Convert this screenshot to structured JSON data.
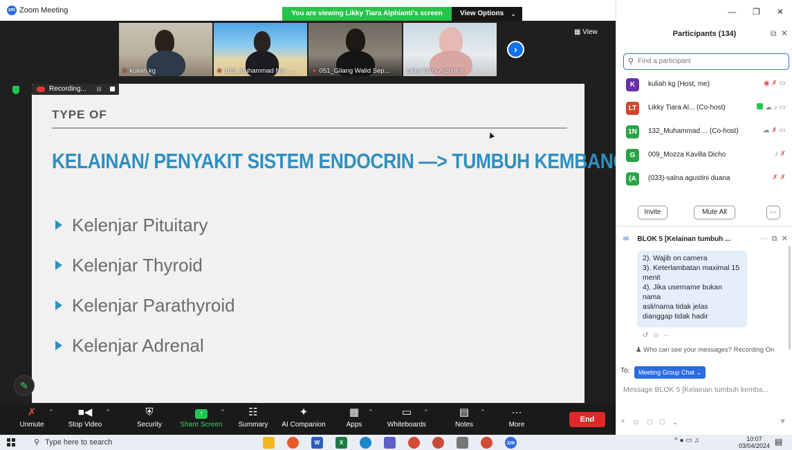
{
  "window": {
    "title": "Zoom Meeting",
    "viewing_banner": "You are viewing Likky Tiara Alphianti's screen",
    "view_options": "View Options",
    "view_label": "View"
  },
  "video_strip": [
    {
      "name": "kuliah kg"
    },
    {
      "name": "132_Muhammad Nur ..."
    },
    {
      "name": "051_Gilang Walid Sep..."
    },
    {
      "name": "Likky Tiara Alphianti"
    }
  ],
  "recording": {
    "label": "Recording...",
    "pause": "II"
  },
  "slide": {
    "heading": "TYPE OF",
    "title": "KELAINAN/ PENYAKIT SISTEM ENDOCRIN —> TUMBUH KEMBANG",
    "bullets": [
      "Kelenjar Pituitary",
      "Kelenjar Thyroid",
      "Kelenjar Parathyroid",
      "Kelenjar Adrenal"
    ],
    "accent_color": "#2f8fbf"
  },
  "toolbar": {
    "unmute": "Unmute",
    "stop_video": "Stop Video",
    "security": "Security",
    "share_screen": "Share Screen",
    "summary": "Summary",
    "ai_companion": "AI Companion",
    "apps": "Apps",
    "whiteboards": "Whiteboards",
    "notes": "Notes",
    "more": "More",
    "end": "End"
  },
  "participants": {
    "title": "Participants (134)",
    "search_placeholder": "Find a participant",
    "list": [
      {
        "initials": "K",
        "name": "kuliah kg (Host, me)",
        "color": "#6b2fa8"
      },
      {
        "initials": "LT",
        "name": "Likky Tiara Al... (Co-host)",
        "color": "#d0452f"
      },
      {
        "initials": "1N",
        "name": "132_Muhammad ... (Co-host)",
        "color": "#2aa546"
      },
      {
        "initials": "G",
        "name": "009_Mozza Kavilla Dicho",
        "color": "#2aa546"
      },
      {
        "initials": "(A",
        "name": "(033)-salna agustini duana",
        "color": "#2aa546"
      }
    ],
    "invite": "Invite",
    "mute_all": "Mute All",
    "more": "···"
  },
  "chat": {
    "title": "BLOK 5 [Kelainan tumbuh ...",
    "message_lines": [
      "2). Wajib on camera",
      "3). Keterlambatan maximal 15",
      "menit",
      "4). Jika username bukan nama",
      "asli/nama tidak jelas",
      "dianggap tidak hadir"
    ],
    "notice": "Who can see your messages? Recording On",
    "to_label": "To:",
    "to_target": "Meeting Group Chat",
    "input_placeholder": "Message BLOK 5 [Kelainan tumbuh kemba..."
  },
  "taskbar": {
    "search": "Type here to search",
    "time": "10:07",
    "date": "03/04/2024"
  }
}
